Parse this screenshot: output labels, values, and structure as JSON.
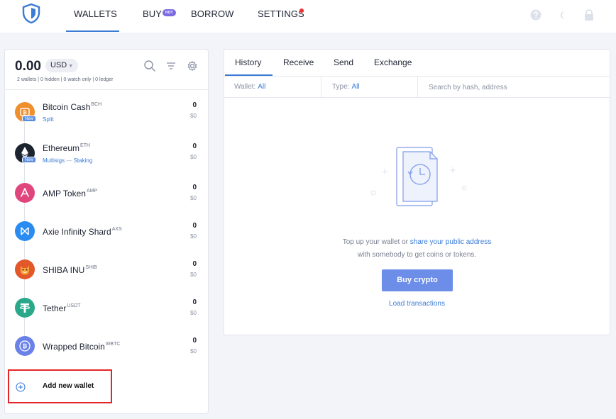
{
  "nav": {
    "wallets": "WALLETS",
    "buy": "BUY",
    "hot_badge": "HOT",
    "borrow": "BORROW",
    "settings": "SETTINGS"
  },
  "summary": {
    "balance": "0.00",
    "currency": "USD",
    "stats": "2 wallets | 0 hidden | 0 watch only | 0 ledger"
  },
  "wallets": [
    {
      "name": "Bitcoin Cash",
      "ticker": "BCH",
      "sub": "Split",
      "amount": "0",
      "fiat": "$0",
      "new": "New",
      "color": "#f08f2e",
      "icon": "bitcoin-cash-icon"
    },
    {
      "name": "Ethereum",
      "ticker": "ETH",
      "sub1": "Multisigs",
      "sub_sep": "—",
      "sub2": "Staking",
      "amount": "0",
      "fiat": "$0",
      "new": "New",
      "color": "#1c2430",
      "icon": "ethereum-icon"
    },
    {
      "name": "AMP Token",
      "ticker": "AMP",
      "amount": "0",
      "fiat": "$0",
      "color": "#e0457b",
      "icon": "amp-icon"
    },
    {
      "name": "Axie Infinity Shard",
      "ticker": "AXS",
      "amount": "0",
      "fiat": "$0",
      "color": "#2a8cf0",
      "icon": "axs-icon"
    },
    {
      "name": "SHIBA INU",
      "ticker": "SHIB",
      "amount": "0",
      "fiat": "$0",
      "color": "#e2582a",
      "icon": "shiba-inu-icon"
    },
    {
      "name": "Tether",
      "ticker": "USDT",
      "amount": "0",
      "fiat": "$0",
      "color": "#2aa88a",
      "icon": "tether-icon"
    },
    {
      "name": "Wrapped Bitcoin",
      "ticker": "WBTC",
      "amount": "0",
      "fiat": "$0",
      "color": "#6a82e8",
      "icon": "wrapped-bitcoin-icon"
    }
  ],
  "add_wallet": "Add new wallet",
  "tabs": [
    "History",
    "Receive",
    "Send",
    "Exchange"
  ],
  "filters": {
    "wallet_label": "Wallet:",
    "wallet_value": "All",
    "type_label": "Type:",
    "type_value": "All",
    "search_placeholder": "Search by hash, address"
  },
  "empty": {
    "line1_pre": "Top up your wallet or",
    "line1_link": "share your public address",
    "line2": "with somebody to get coins or tokens.",
    "buy_button": "Buy crypto",
    "load_link": "Load transactions"
  },
  "colors": {
    "accent": "#3a7bd5",
    "button": "#6c8ee8",
    "highlight_box": "#e32629",
    "notification_dot": "#e8343a"
  }
}
